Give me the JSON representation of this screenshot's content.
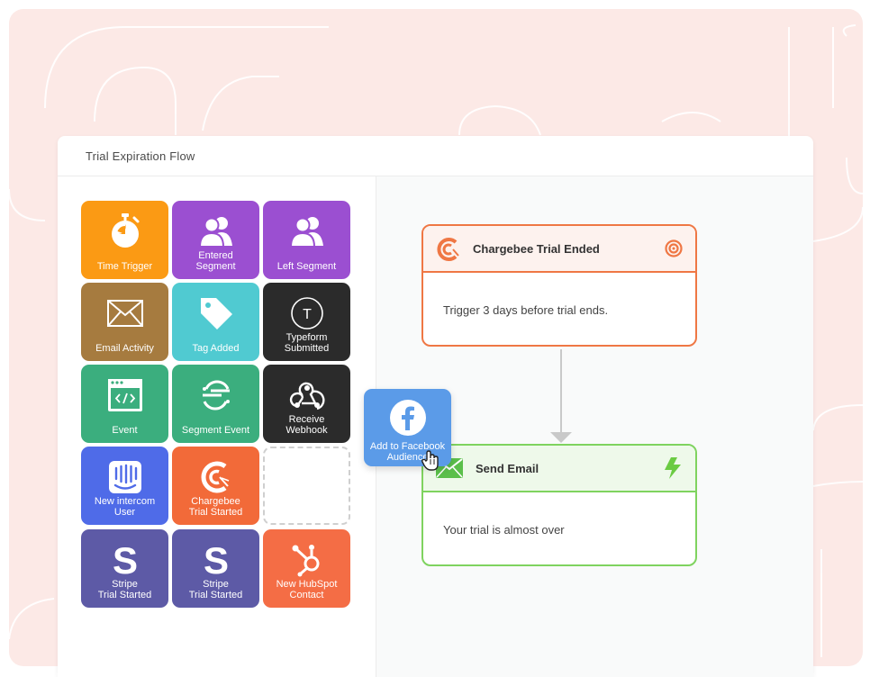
{
  "window": {
    "title": "Trial Expiration Flow"
  },
  "palette": {
    "tiles": [
      {
        "label": "Time Trigger",
        "color": "#fb9a14",
        "icon": "stopwatch-icon"
      },
      {
        "label": "Entered\nSegment",
        "color": "#9b4fd1",
        "icon": "users-icon"
      },
      {
        "label": "Left Segment",
        "color": "#9b4fd1",
        "icon": "users-icon"
      },
      {
        "label": "Email Activity",
        "color": "#a67b3f",
        "icon": "envelope-icon"
      },
      {
        "label": "Tag Added",
        "color": "#50cad1",
        "icon": "tag-icon"
      },
      {
        "label": "Typeform\nSubmitted",
        "color": "#2b2b2b",
        "icon": "typeform-icon"
      },
      {
        "label": "Event",
        "color": "#3bae7e",
        "icon": "code-window-icon"
      },
      {
        "label": "Segment Event",
        "color": "#3bae7e",
        "icon": "segment-icon"
      },
      {
        "label": "Receive\nWebhook",
        "color": "#2b2b2b",
        "icon": "webhook-icon"
      },
      {
        "label": "New intercom\nUser",
        "color": "#4f6be8",
        "icon": "intercom-icon"
      },
      {
        "label": "Chargebee\nTrial Started",
        "color": "#f26a39",
        "icon": "chargebee-icon"
      },
      {
        "label": "",
        "color": "",
        "icon": ""
      },
      {
        "label": "Stripe\nTrial Started",
        "color": "#5d5aa6",
        "icon": "stripe-icon"
      },
      {
        "label": "Stripe\nTrial Started",
        "color": "#5d5aa6",
        "icon": "stripe-icon"
      },
      {
        "label": "New HubSpot\nContact",
        "color": "#f46d45",
        "icon": "hubspot-icon"
      }
    ]
  },
  "dragging": {
    "label": "Add to Facebook\nAudience",
    "color": "#5b9be8",
    "icon": "facebook-icon"
  },
  "flow": {
    "trigger": {
      "title": "Chargebee Trial Ended",
      "body": "Trigger 3 days before trial ends.",
      "border": "#ef7744",
      "header_bg": "#fdf2ee",
      "icon": "chargebee-icon",
      "status_icon": "target-icon"
    },
    "action": {
      "title": "Send Email",
      "body": "Your trial is almost over",
      "border": "#7fd35f",
      "header_bg": "#eef9ea",
      "icon": "envelope-icon",
      "status_icon": "lightning-icon"
    }
  }
}
